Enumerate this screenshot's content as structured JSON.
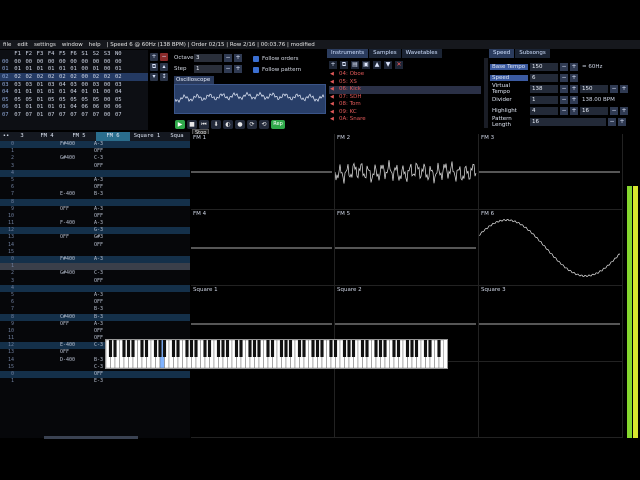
{
  "menubar": {
    "items": [
      "file",
      "edit",
      "settings",
      "window",
      "help"
    ],
    "status": "| Speed 6 @ 60Hz (138 BPM) | Order 02/15 | Row 2/16 | 00:03.76 | modified"
  },
  "orders": {
    "headers": [
      "F1",
      "F2",
      "F3",
      "F4",
      "F5",
      "F6",
      "S1",
      "S2",
      "S3",
      "N0"
    ],
    "rows": [
      {
        "no": "00",
        "cells": [
          "00",
          "00",
          "00",
          "00",
          "00",
          "00",
          "00",
          "00",
          "00",
          "00"
        ]
      },
      {
        "no": "01",
        "cells": [
          "01",
          "01",
          "01",
          "01",
          "01",
          "01",
          "00",
          "01",
          "00",
          "01"
        ]
      },
      {
        "no": "02",
        "cells": [
          "02",
          "02",
          "02",
          "02",
          "02",
          "02",
          "00",
          "02",
          "02",
          "02"
        ]
      },
      {
        "no": "03",
        "cells": [
          "03",
          "03",
          "01",
          "03",
          "04",
          "03",
          "00",
          "03",
          "00",
          "03"
        ]
      },
      {
        "no": "04",
        "cells": [
          "01",
          "01",
          "01",
          "01",
          "01",
          "04",
          "01",
          "01",
          "00",
          "04"
        ]
      },
      {
        "no": "05",
        "cells": [
          "05",
          "05",
          "01",
          "05",
          "05",
          "05",
          "05",
          "05",
          "00",
          "05"
        ]
      },
      {
        "no": "06",
        "cells": [
          "01",
          "01",
          "01",
          "01",
          "01",
          "04",
          "06",
          "06",
          "00",
          "06"
        ]
      },
      {
        "no": "07",
        "cells": [
          "07",
          "07",
          "01",
          "07",
          "07",
          "07",
          "07",
          "07",
          "00",
          "07"
        ]
      }
    ]
  },
  "octave": {
    "label": "Octave",
    "value": "3"
  },
  "step": {
    "label": "Step",
    "value": "1"
  },
  "follow": {
    "orders": "Follow orders",
    "pattern": "Follow pattern"
  },
  "oscilloscope": {
    "tab": "Oscilloscope"
  },
  "playback": {
    "rep": "Rep",
    "tooltip": "Stop"
  },
  "instruments": {
    "tabs": [
      "Instruments",
      "Samples",
      "Wavetables"
    ],
    "items": [
      "04: Oboe",
      "05: XS",
      "06: Kick",
      "07: SDH",
      "08: Tom",
      "09: KC",
      "0A: Snare"
    ]
  },
  "speed": {
    "tabs": [
      "Speed",
      "Subsongs"
    ],
    "base_tempo": {
      "label": "Base Tempo",
      "value": "150",
      "note": "= 60Hz"
    },
    "speed": {
      "label": "Speed",
      "value": "6"
    },
    "virtual_tempo": {
      "label": "Virtual Tempo",
      "value": "138",
      "value2": "150"
    },
    "divider": {
      "label": "Divider",
      "value": "1",
      "note": "138.00 BPM"
    },
    "highlight": {
      "label": "Highlight",
      "value": "4",
      "value2": "16"
    },
    "pattern_length": {
      "label": "Pattern Length",
      "value": "16"
    }
  },
  "pattern": {
    "channels": [
      "3",
      "FM 4",
      "FM 5",
      "FM 6",
      "Square 1",
      "Squa"
    ],
    "rows": [
      {
        "no": "0",
        "a": "",
        "b": "F#400",
        "c": "A-3"
      },
      {
        "no": "1",
        "a": "",
        "b": "",
        "c": "OFF"
      },
      {
        "no": "2",
        "a": "",
        "b": "G#400",
        "c": "C-3"
      },
      {
        "no": "3",
        "a": "",
        "b": "",
        "c": "OFF"
      },
      {
        "no": "4",
        "a": "",
        "b": "",
        "c": ""
      },
      {
        "no": "5",
        "a": "",
        "b": "",
        "c": "A-3"
      },
      {
        "no": "6",
        "a": "",
        "b": "",
        "c": "OFF"
      },
      {
        "no": "7",
        "a": "",
        "b": "E-400",
        "c": "B-3"
      },
      {
        "no": "8",
        "a": "",
        "b": "",
        "c": ""
      },
      {
        "no": "9",
        "a": "",
        "b": "OFF",
        "c": "A-3"
      },
      {
        "no": "10",
        "a": "",
        "b": "",
        "c": "OFF"
      },
      {
        "no": "11",
        "a": "",
        "b": "F-400",
        "c": "A-3"
      },
      {
        "no": "12",
        "a": "",
        "b": "",
        "c": "G-3"
      },
      {
        "no": "13",
        "a": "",
        "b": "OFF",
        "c": "G#3"
      },
      {
        "no": "14",
        "a": "",
        "b": "",
        "c": "OFF"
      },
      {
        "no": "15",
        "a": "",
        "b": "",
        "c": ""
      },
      {
        "no": "0",
        "a": "",
        "b": "F#400",
        "c": "A-3"
      },
      {
        "no": "1",
        "a": "",
        "b": "",
        "c": ""
      },
      {
        "no": "2",
        "a": "",
        "b": "G#400",
        "c": "C-3"
      },
      {
        "no": "3",
        "a": "",
        "b": "",
        "c": "OFF"
      },
      {
        "no": "4",
        "a": "",
        "b": "",
        "c": ""
      },
      {
        "no": "5",
        "a": "",
        "b": "",
        "c": "A-3"
      },
      {
        "no": "6",
        "a": "",
        "b": "",
        "c": "OFF"
      },
      {
        "no": "7",
        "a": "",
        "b": "",
        "c": "B-3"
      },
      {
        "no": "8",
        "a": "",
        "b": "C#400",
        "c": "B-3"
      },
      {
        "no": "9",
        "a": "",
        "b": "OFF",
        "c": "A-3"
      },
      {
        "no": "10",
        "a": "",
        "b": "",
        "c": "OFF"
      },
      {
        "no": "11",
        "a": "",
        "b": "",
        "c": "OFF"
      },
      {
        "no": "12",
        "a": "",
        "b": "E-400",
        "c": "C-3"
      },
      {
        "no": "13",
        "a": "",
        "b": "OFF",
        "c": ""
      },
      {
        "no": "14",
        "a": "",
        "b": "D-400",
        "c": "B-3"
      },
      {
        "no": "15",
        "a": "",
        "b": "",
        "c": "C-3"
      },
      {
        "no": "0",
        "a": "",
        "b": "",
        "c": "OFF"
      },
      {
        "no": "1",
        "a": "",
        "b": "",
        "c": "E-3"
      }
    ]
  },
  "oscgrid": {
    "labels": [
      "FM 1",
      "FM 2",
      "FM 3",
      "FM 4",
      "FM 5",
      "FM 6",
      "Square 1",
      "Square 2",
      "Square 3",
      "",
      "",
      ""
    ]
  },
  "colors": {
    "accent": "#2a6d8c",
    "vu_green": "#86d82f",
    "vu_yellow": "#d8e62f",
    "inst_red": "#e35a5a"
  }
}
